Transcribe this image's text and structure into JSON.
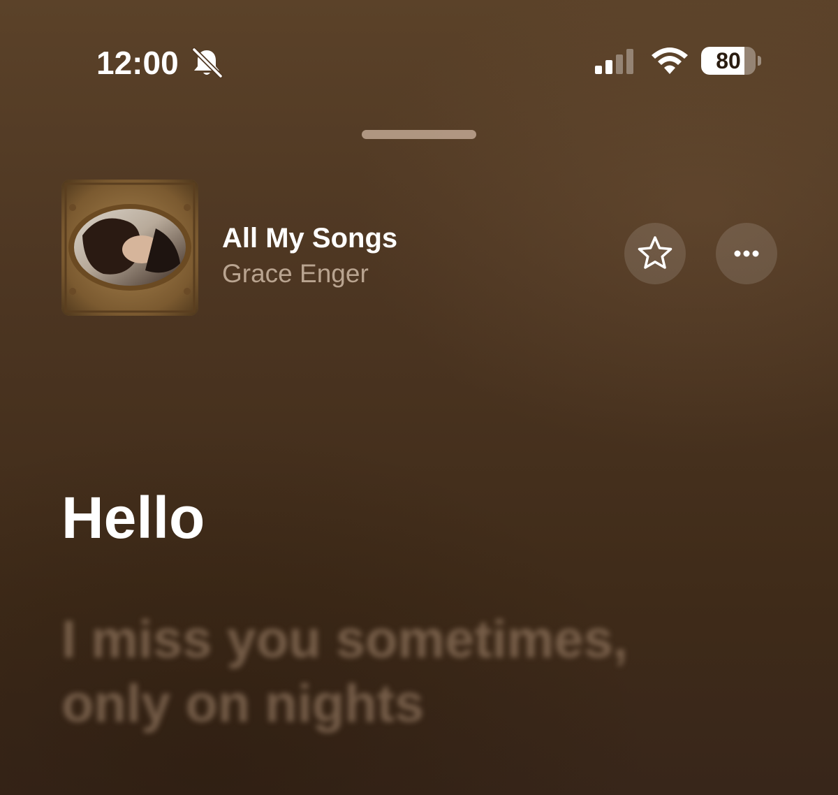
{
  "status_bar": {
    "time": "12:00",
    "battery_level": "80",
    "battery_fraction": 0.8,
    "icons": [
      "bell-slash-icon",
      "cellular-signal-icon",
      "wifi-icon",
      "battery-icon"
    ]
  },
  "now_playing": {
    "title": "All My Songs",
    "artist": "Grace Enger",
    "artwork_icon": "album-artwork",
    "favorite_icon": "star-icon",
    "more_icon": "ellipsis-icon"
  },
  "lyrics": {
    "current": "Hello",
    "next_lines": [
      "I miss you sometimes,",
      "only on nights"
    ]
  },
  "colors": {
    "background": "#4d3622",
    "text_primary": "#ffffff",
    "text_secondary": "#d7c3af"
  }
}
